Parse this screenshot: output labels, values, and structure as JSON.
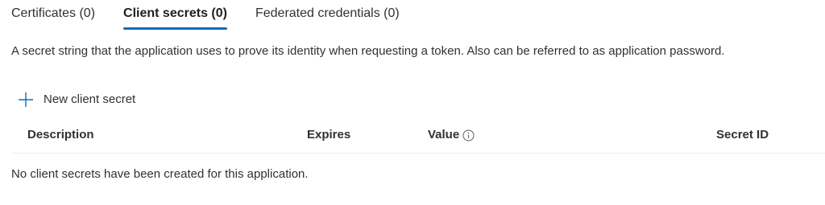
{
  "tabs": [
    {
      "label": "Certificates (0)",
      "active": false
    },
    {
      "label": "Client secrets (0)",
      "active": true
    },
    {
      "label": "Federated credentials (0)",
      "active": false
    }
  ],
  "description": "A secret string that the application uses to prove its identity when requesting a token. Also can be referred to as application password.",
  "toolbar": {
    "new_label": "New client secret",
    "new_icon": "plus-icon"
  },
  "table": {
    "columns": {
      "description": "Description",
      "expires": "Expires",
      "value": "Value",
      "secret_id": "Secret ID"
    },
    "value_info_icon": "info-icon",
    "empty_message": "No client secrets have been created for this application."
  },
  "colors": {
    "accent": "#0f6cbd",
    "text": "#323130",
    "divider": "#edebe9"
  }
}
